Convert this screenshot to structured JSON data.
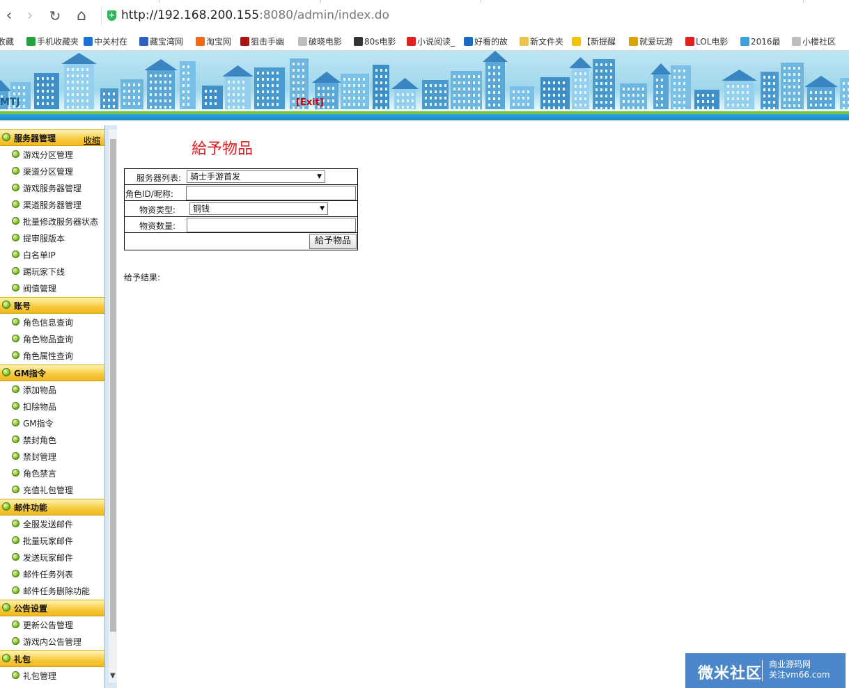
{
  "browser": {
    "url_host": "http://192.168.200.155",
    "url_rest": ":8080/admin/index.do",
    "bookmarks": [
      "收藏",
      "手机收藏夹",
      "中关村在",
      "藏宝湾网",
      "淘宝网",
      "狙击手幽",
      "破晓电影",
      "80s电影",
      "小说阅读_",
      "好看的故",
      "新文件夹",
      "【新提醒",
      "就爱玩游",
      "LOL电影",
      "2016最",
      "小楼社区"
    ],
    "bookmark_colors": [
      "#888888",
      "#27a042",
      "#1f6fd6",
      "#2f5fbf",
      "#f26a10",
      "#b01010",
      "#bdbdbd",
      "#333333",
      "#e02020",
      "#1b6ac2",
      "#e8c24a",
      "#f5c400",
      "#d8a400",
      "#e02020",
      "#3aa0e0",
      "#bdbdbd"
    ]
  },
  "header": {
    "brand": "MTJ",
    "exit_label": "[Exit]"
  },
  "sidebar": {
    "collapse_label": "收缩",
    "groups": [
      {
        "title": "服务器管理",
        "items": [
          "游戏分区管理",
          "渠道分区管理",
          "游戏服务器管理",
          "渠道服务器管理",
          "批量修改服务器状态",
          "提审服版本",
          "白名单IP",
          "踢玩家下线",
          "阀值管理"
        ]
      },
      {
        "title": "账号",
        "items": [
          "角色信息查询",
          "角色物品查询",
          "角色属性查询"
        ]
      },
      {
        "title": "GM指令",
        "items": [
          "添加物品",
          "扣除物品",
          "GM指令",
          "禁封角色",
          "禁封管理",
          "角色禁言",
          "充值礼包管理"
        ]
      },
      {
        "title": "邮件功能",
        "items": [
          "全服发送邮件",
          "批量玩家邮件",
          "发送玩家邮件",
          "邮件任务列表",
          "邮件任务删除功能"
        ]
      },
      {
        "title": "公告设置",
        "items": [
          "更新公告管理",
          "游戏内公告管理"
        ]
      },
      {
        "title": "礼包",
        "items": [
          "礼包管理"
        ]
      }
    ]
  },
  "form": {
    "title": "給予物品",
    "server_label": "服务器列表:",
    "server_value": "骑士手游首发",
    "role_label": "角色ID/昵称:",
    "role_value": "",
    "type_label": "物资类型:",
    "type_value": "铜钱",
    "qty_label": "物资数量:",
    "qty_value": "",
    "submit_label": "給予物品",
    "result_label": "给予结果:"
  },
  "watermark": {
    "name": "微米社区",
    "line1": "商业源码网",
    "line2": "关注vm66.com"
  }
}
